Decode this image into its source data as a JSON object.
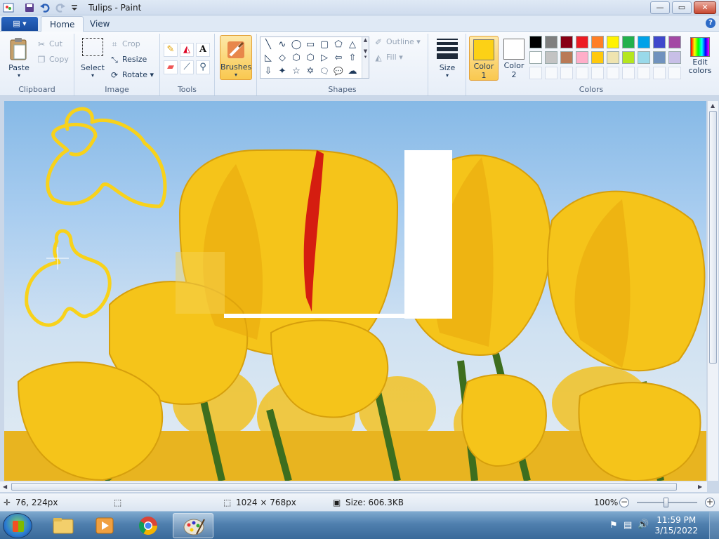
{
  "window": {
    "title": "Tulips - Paint",
    "quick_access": [
      "save-icon",
      "undo-icon",
      "redo-icon",
      "customize-quick-access-icon"
    ],
    "controls": {
      "minimize": "—",
      "maximize": "▭",
      "close": "✕"
    }
  },
  "tabs": {
    "app_menu_glyph": "▤ ▾",
    "items": [
      {
        "label": "Home",
        "active": true
      },
      {
        "label": "View",
        "active": false
      }
    ],
    "help_glyph": "?"
  },
  "ribbon": {
    "clipboard": {
      "label": "Clipboard",
      "paste": "Paste",
      "cut": "Cut",
      "copy": "Copy"
    },
    "image": {
      "label": "Image",
      "select": "Select",
      "crop": "Crop",
      "resize": "Resize",
      "rotate": "Rotate"
    },
    "tools": {
      "label": "Tools",
      "items": [
        "pencil-icon",
        "fill-icon",
        "text-icon",
        "eraser-icon",
        "color-picker-icon",
        "magnifier-icon"
      ]
    },
    "brushes": {
      "label": "Brushes"
    },
    "shapes": {
      "label": "Shapes",
      "outline": "Outline",
      "fill": "Fill",
      "glyphs": [
        "╲",
        "∿",
        "◯",
        "▭",
        "▢",
        "⬠",
        "△",
        "◺",
        "◇",
        "⬡",
        "⬡",
        "▷",
        "⇦",
        "⇧",
        "⇩",
        "✦",
        "☆",
        "✡",
        "🗨",
        "💬",
        "☁"
      ]
    },
    "size": {
      "label": "Size"
    },
    "colors": {
      "label": "Colors",
      "color1": {
        "label": "Color",
        "number": "1",
        "value": "#fcd116"
      },
      "color2": {
        "label": "Color",
        "number": "2",
        "value": "#ffffff"
      },
      "row1": [
        "#000000",
        "#7f7f7f",
        "#880015",
        "#ed1c24",
        "#ff7f27",
        "#fff200",
        "#22b14c",
        "#00a2e8",
        "#3f48cc",
        "#a349a4"
      ],
      "row2": [
        "#ffffff",
        "#c3c3c3",
        "#b97a57",
        "#ffaec9",
        "#ffc90e",
        "#efe4b0",
        "#b5e61d",
        "#99d9ea",
        "#7092be",
        "#c8bfe7"
      ],
      "edit_colors": "Edit colors"
    }
  },
  "status": {
    "cursor_position": "76, 224px",
    "selection_size": "",
    "image_dimensions": "1024 × 768px",
    "file_size": "Size: 606.3KB",
    "zoom": "100%",
    "zoom_level": 1.0
  },
  "taskbar": {
    "items": [
      {
        "name": "windows-explorer",
        "active": false
      },
      {
        "name": "media-player",
        "active": false
      },
      {
        "name": "google-chrome",
        "active": false
      },
      {
        "name": "paint",
        "active": true
      }
    ],
    "time": "11:59 PM",
    "date": "3/15/2022"
  }
}
